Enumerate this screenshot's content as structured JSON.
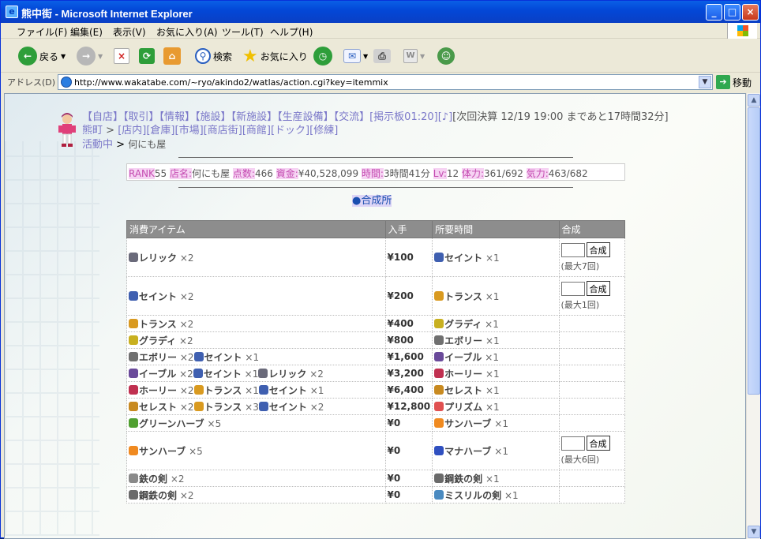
{
  "window": {
    "title": "熊中街 - Microsoft Internet Explorer",
    "min": "_",
    "max": "□",
    "close": "×"
  },
  "menu": [
    "ファイル(F)",
    "編集(E)",
    "表示(V)",
    "お気に入り(A)",
    "ツール(T)",
    "ヘルプ(H)"
  ],
  "toolbar": {
    "back": "戻る",
    "search": "検索",
    "favorites": "お気に入り"
  },
  "address": {
    "label": "アドレス(D)",
    "url": "http://www.wakatabe.com/~ryo/akindo2/watlas/action.cgi?key=itemmix",
    "go": "移動"
  },
  "nav": {
    "line1": [
      "【自店】",
      "【取引】",
      "【情報】",
      "【施設】",
      "【新施設】",
      "【生産設備】",
      "【交流】",
      "[掲示板01:20]",
      "[♪]"
    ],
    "settle": "[次回決算 12/19 19:00 まであと17時間32分]",
    "line2_town": "熊町",
    "line2": [
      "[店内]",
      "[倉庫]",
      "[市場]",
      "[商店街]",
      "[商館]",
      "[ドック]",
      "[修練]"
    ],
    "line3_status": "活動中",
    "line3_shop": "何にも屋"
  },
  "stats": {
    "rank_k": "RANK",
    "rank_v": "55",
    "shop_k": "店名:",
    "shop_v": "何にも屋",
    "points_k": "点数:",
    "points_v": "466",
    "funds_k": "資金:",
    "funds_v": "¥40,528,099",
    "time_k": "時間:",
    "time_v": "3時間41分",
    "lv_k": "Lv:",
    "lv_v": "12",
    "hp_k": "体力:",
    "hp_v": "361/692",
    "mp_k": "気力:",
    "mp_v": "463/682"
  },
  "section_title": "●合成所",
  "table": {
    "headers": [
      "消費アイテム",
      "入手",
      "所要時間",
      "合成"
    ],
    "mix_label": "合成",
    "rows": [
      {
        "items": [
          {
            "n": "レリック",
            "q": "×2",
            "c": "#6a6a7a"
          }
        ],
        "price": "¥100",
        "result": {
          "n": "セイント",
          "q": "×1",
          "c": "#3f5fb0"
        },
        "max": "(最大7回)",
        "tall": true
      },
      {
        "items": [
          {
            "n": "セイント",
            "q": "×2",
            "c": "#3f5fb0"
          }
        ],
        "price": "¥200",
        "result": {
          "n": "トランス",
          "q": "×1",
          "c": "#d99a20"
        },
        "max": "(最大1回)",
        "tall": true
      },
      {
        "items": [
          {
            "n": "トランス",
            "q": "×2",
            "c": "#d99a20"
          }
        ],
        "price": "¥400",
        "result": {
          "n": "グラディ",
          "q": "×1",
          "c": "#c8b020"
        }
      },
      {
        "items": [
          {
            "n": "グラディ",
            "q": "×2",
            "c": "#c8b020"
          }
        ],
        "price": "¥800",
        "result": {
          "n": "エボリー",
          "q": "×1",
          "c": "#707070"
        }
      },
      {
        "items": [
          {
            "n": "エボリー",
            "q": "×2",
            "c": "#707070"
          },
          {
            "n": "セイント",
            "q": "×1",
            "c": "#3f5fb0"
          }
        ],
        "price": "¥1,600",
        "result": {
          "n": "イーブル",
          "q": "×1",
          "c": "#6a4a9a"
        }
      },
      {
        "items": [
          {
            "n": "イーブル",
            "q": "×2",
            "c": "#6a4a9a"
          },
          {
            "n": "セイント",
            "q": "×1",
            "c": "#3f5fb0"
          },
          {
            "n": "レリック",
            "q": "×2",
            "c": "#6a6a7a"
          }
        ],
        "price": "¥3,200",
        "result": {
          "n": "ホーリー",
          "q": "×1",
          "c": "#c03050"
        }
      },
      {
        "items": [
          {
            "n": "ホーリー",
            "q": "×2",
            "c": "#c03050"
          },
          {
            "n": "トランス",
            "q": "×1",
            "c": "#d99a20"
          },
          {
            "n": "セイント",
            "q": "×1",
            "c": "#3f5fb0"
          }
        ],
        "price": "¥6,400",
        "result": {
          "n": "セレスト",
          "q": "×1",
          "c": "#c88a20"
        }
      },
      {
        "items": [
          {
            "n": "セレスト",
            "q": "×2",
            "c": "#c88a20"
          },
          {
            "n": "トランス",
            "q": "×3",
            "c": "#d99a20"
          },
          {
            "n": "セイント",
            "q": "×2",
            "c": "#3f5fb0"
          }
        ],
        "price": "¥12,800",
        "result": {
          "n": "プリズム",
          "q": "×1",
          "c": "#e05050"
        }
      },
      {
        "items": [
          {
            "n": "グリーンハーブ",
            "q": "×5",
            "c": "#50a030"
          }
        ],
        "price": "¥0",
        "result": {
          "n": "サンハーブ",
          "q": "×1",
          "c": "#f08a20"
        }
      },
      {
        "items": [
          {
            "n": "サンハーブ",
            "q": "×5",
            "c": "#f08a20"
          }
        ],
        "price": "¥0",
        "result": {
          "n": "マナハーブ",
          "q": "×1",
          "c": "#3050c0"
        },
        "max": "(最大6回)",
        "tall": true
      },
      {
        "items": [
          {
            "n": "鉄の剣",
            "q": "×2",
            "c": "#8a8a8a"
          }
        ],
        "price": "¥0",
        "result": {
          "n": "鋼鉄の剣",
          "q": "×1",
          "c": "#6a6a6a"
        }
      },
      {
        "items": [
          {
            "n": "鋼鉄の剣",
            "q": "×2",
            "c": "#6a6a6a"
          }
        ],
        "price": "¥0",
        "result": {
          "n": "ミスリルの剣",
          "q": "×1",
          "c": "#4a8ac0"
        }
      }
    ]
  }
}
